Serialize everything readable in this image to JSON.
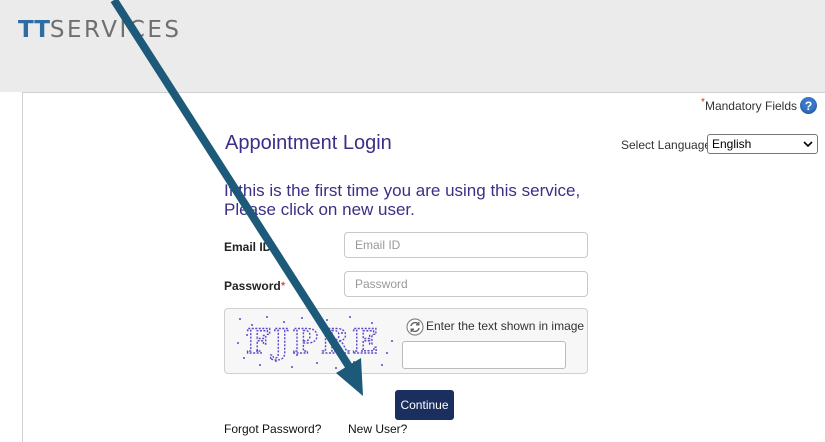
{
  "header": {
    "logo_tt": "TT",
    "logo_rest": "SERVICES"
  },
  "mandatory": {
    "star": "*",
    "label": "Mandatory Fields",
    "help_icon": "?"
  },
  "page": {
    "title": "Appointment Login"
  },
  "language": {
    "label": "Select Language :",
    "selected": "English"
  },
  "intro": "If this is the first time you are using this service, Please click on new user.",
  "form": {
    "email_label": "Email ID",
    "email_placeholder": "Email ID",
    "password_label": "Password",
    "password_star": "*",
    "password_placeholder": "Password",
    "captcha_text": "FJPRE",
    "captcha_prompt": "Enter the text shown in image",
    "continue_label": "Continue"
  },
  "links": {
    "forgot": "Forgot Password?",
    "new_user": "New User?"
  },
  "colors": {
    "arrow": "#1d5a79",
    "title": "#3b2f86",
    "button": "#1a2f5e"
  }
}
